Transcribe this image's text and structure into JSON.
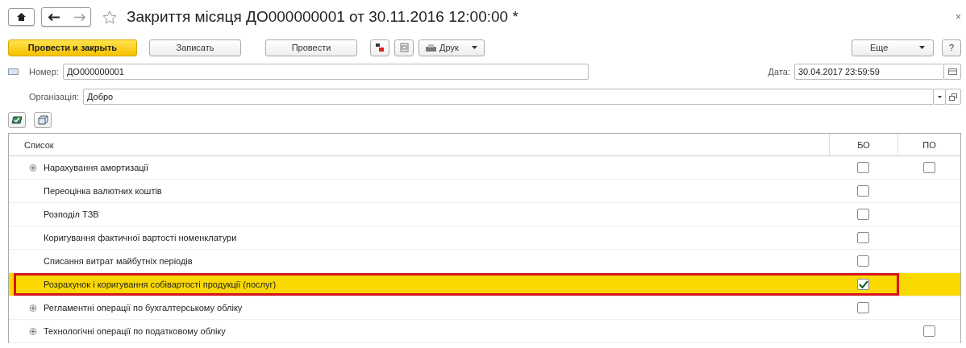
{
  "window": {
    "title": "Закриття місяця ДО000000001 от 30.11.2016 12:00:00 *",
    "close": "×"
  },
  "toolbar": {
    "buttons": [
      {
        "label": "Провести и закрыть",
        "kind": "primary"
      },
      {
        "label": "Записать",
        "kind": "plain"
      },
      {
        "label": "Провести",
        "kind": "plain"
      }
    ],
    "print": "Друк",
    "more": "Еще",
    "help": "?"
  },
  "fields": {
    "number_label": "Номер:",
    "number": "ДО000000001",
    "date_label": "Дата:",
    "date": "30.04.2017 23:59:59",
    "org_label": "Організація:",
    "org": "Добро"
  },
  "table": {
    "columns": [
      "Список",
      "БО",
      "ПО"
    ],
    "rows": [
      {
        "label": "Нарахування амортизації",
        "expandable": true,
        "bo": false,
        "po": false,
        "selected": false,
        "highlighted": false
      },
      {
        "label": "Переоцінка валютних коштів",
        "expandable": false,
        "bo": false,
        "selected": false,
        "highlighted": false
      },
      {
        "label": "Розподіл ТЗВ",
        "expandable": false,
        "bo": false,
        "selected": false,
        "highlighted": false
      },
      {
        "label": "Коригування фактичної вартості номенклатури",
        "expandable": false,
        "bo": false,
        "selected": false,
        "highlighted": false
      },
      {
        "label": "Списання витрат майбутніх періодів",
        "expandable": false,
        "bo": false,
        "selected": false,
        "highlighted": false
      },
      {
        "label": "Розрахунок і коригування собівартості продукції (послуг)",
        "expandable": false,
        "bo": true,
        "selected": true,
        "highlighted": true
      },
      {
        "label": "Регламентні операції по бухгалтерському обліку",
        "expandable": true,
        "bo": false,
        "selected": false,
        "highlighted": false
      },
      {
        "label": "Технологічні операції по податковому обліку",
        "expandable": true,
        "po": false,
        "selected": false,
        "highlighted": false
      }
    ]
  }
}
